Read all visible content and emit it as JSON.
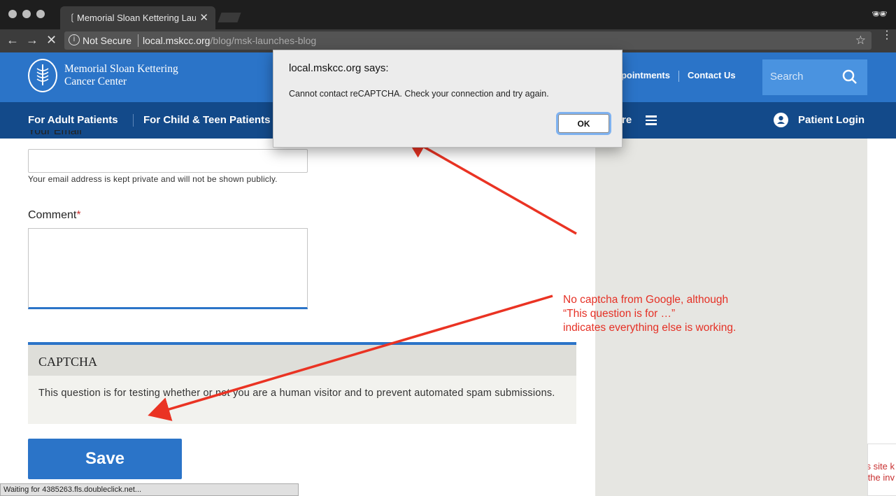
{
  "browser": {
    "tab_title": "Memorial Sloan Kettering Laun",
    "security_label": "Not Secure",
    "url_host": "local.mskcc.org",
    "url_path": "/blog/msk-launches-blog"
  },
  "header": {
    "logo_line1": "Memorial Sloan Kettering",
    "logo_line2": "Cancer Center",
    "toplink_appointments": "ppointments",
    "toplink_contact": "Contact Us",
    "search_placeholder": "Search"
  },
  "nav": {
    "items": [
      "For Adult Patients",
      "For Child & Teen Patients"
    ],
    "more_fragment": "re",
    "patient_login": "Patient Login"
  },
  "form": {
    "email_label": "Your Email",
    "email_help": "Your email address is kept private and will not be shown publicly.",
    "comment_label": "Comment",
    "required_mark": "*",
    "captcha_title": "CAPTCHA",
    "captcha_desc": "This question is for testing whether or not you are a human visitor and to prevent automated spam submissions.",
    "save_label": "Save"
  },
  "status_bar": "Waiting for 4385263.fls.doubleclick.net...",
  "recaptcha_peek": [
    "s site k",
    "the inv"
  ],
  "annotation": [
    "No captcha from Google, although",
    "“This question is for …”",
    "indicates everything else is working."
  ],
  "dialog": {
    "title": "local.mskcc.org says:",
    "message": "Cannot contact reCAPTCHA. Check your connection and try again.",
    "ok_label": "OK"
  },
  "colors": {
    "brand_blue": "#2b74c8",
    "nav_dark_blue": "#134a8a",
    "annotation_red": "#e53025"
  }
}
